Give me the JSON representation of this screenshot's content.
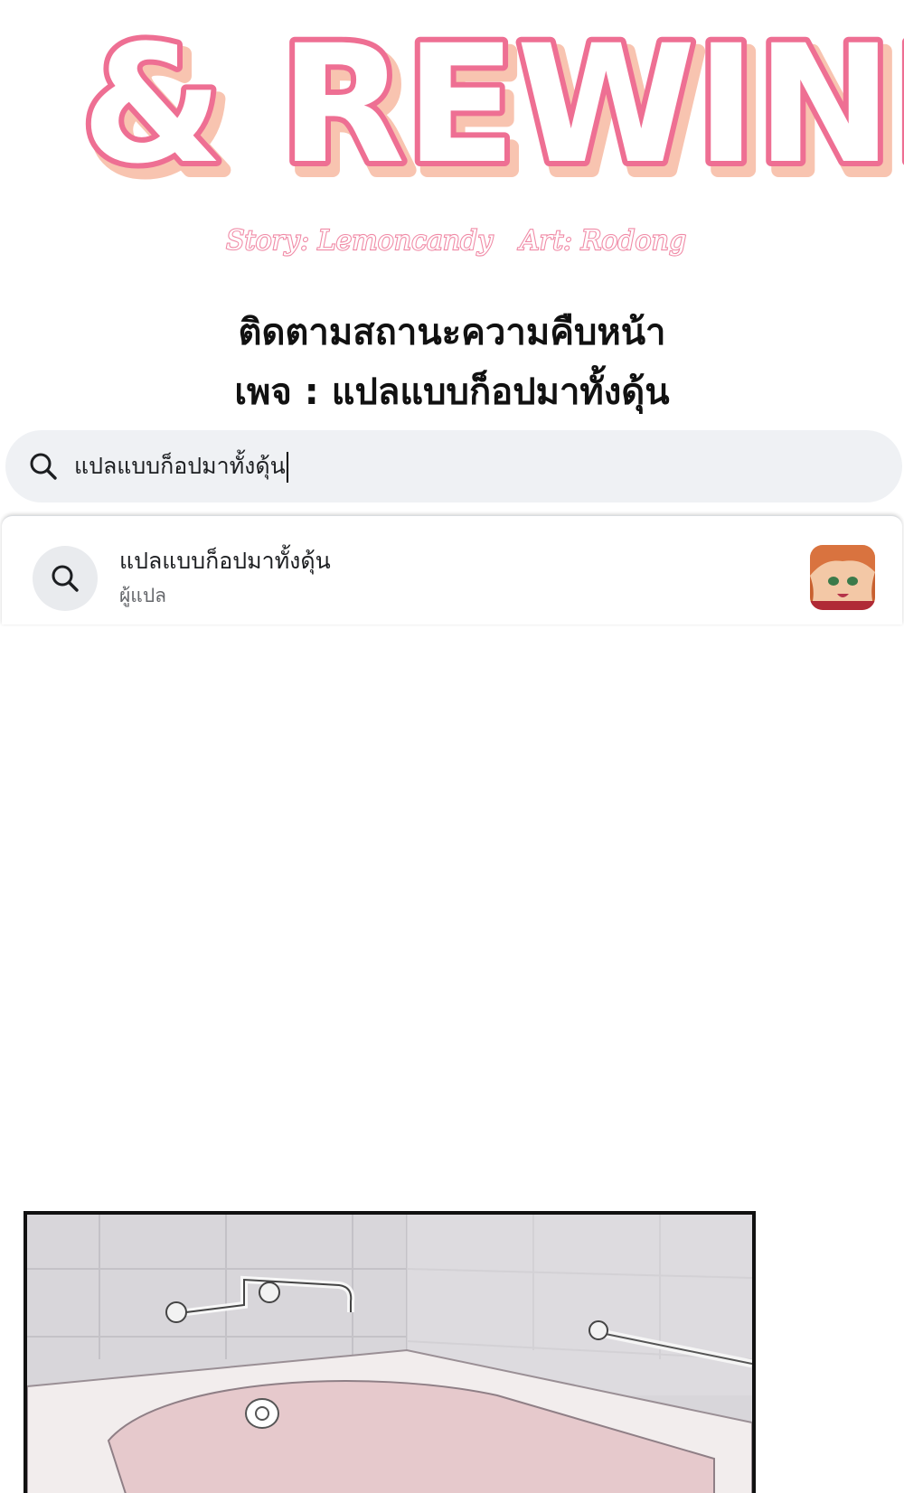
{
  "logo": {
    "title_fragment": "& REWIND",
    "colors": {
      "fill": "#ffffff",
      "outline": "#ee6f93",
      "shadow": "#f8c4b0"
    }
  },
  "credits": {
    "story": "Story: Lemoncandy",
    "art": "Art: Rodong",
    "color": "#f08aa6"
  },
  "notice": {
    "line1": "ติดตามสถานะความคืบหน้า",
    "line2": "เพจ : แปลแบบก็อปมาทั้งดุ้น"
  },
  "search": {
    "value": "แปลแบบก็อปมาทั้งดุ้น",
    "icon": "search-icon"
  },
  "result": {
    "title": "แปลแบบก็อปมาทั้งดุ้น",
    "subtitle": "ผู้แปล",
    "icon": "search-icon",
    "avatar": "page-avatar"
  },
  "panel": {
    "scene": "bathroom-bathtub-illustration"
  }
}
